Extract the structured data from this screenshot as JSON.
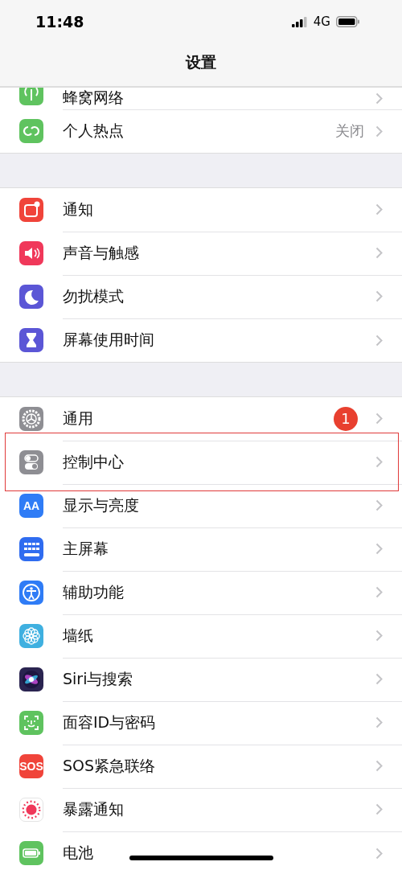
{
  "status_bar": {
    "time": "11:48",
    "network": "4G"
  },
  "nav": {
    "title": "设置"
  },
  "groups": [
    {
      "items": [
        {
          "label": "蜂窝网络",
          "kind": "antenna",
          "partial": true
        },
        {
          "label": "个人热点",
          "kind": "hotspot",
          "value": "关闭"
        }
      ]
    },
    {
      "items": [
        {
          "label": "通知",
          "kind": "notify"
        },
        {
          "label": "声音与触感",
          "kind": "sound"
        },
        {
          "label": "勿扰模式",
          "kind": "moon"
        },
        {
          "label": "屏幕使用时间",
          "kind": "hourglass"
        }
      ]
    },
    {
      "items": [
        {
          "label": "通用",
          "kind": "gear",
          "badge": "1"
        },
        {
          "label": "控制中心",
          "kind": "toggles",
          "highlighted": true
        },
        {
          "label": "显示与亮度",
          "kind": "text",
          "icon_label": "AA"
        },
        {
          "label": "主屏幕",
          "kind": "grid"
        },
        {
          "label": "辅助功能",
          "kind": "access"
        },
        {
          "label": "墙纸",
          "kind": "flower"
        },
        {
          "label": "Siri与搜索",
          "kind": "siri"
        },
        {
          "label": "面容ID与密码",
          "kind": "face"
        },
        {
          "label": "SOS紧急联络",
          "kind": "sos",
          "icon_label": "SOS"
        },
        {
          "label": "暴露通知",
          "kind": "exposure"
        },
        {
          "label": "电池",
          "kind": "battery"
        }
      ]
    }
  ]
}
